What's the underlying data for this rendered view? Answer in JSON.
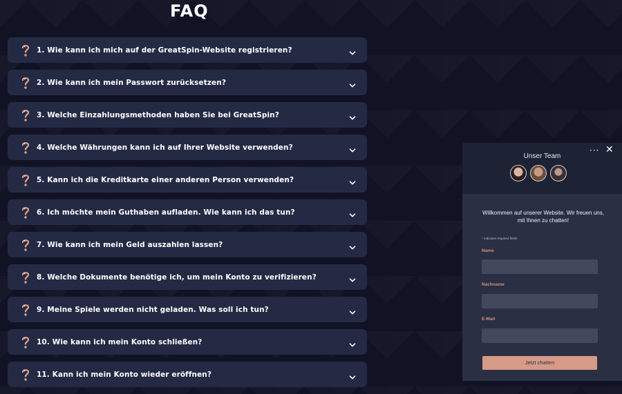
{
  "page": {
    "title": "FAQ"
  },
  "faq": {
    "items": [
      {
        "label": "1. Wie kann ich mich auf der GreatSpin-Website registrieren?"
      },
      {
        "label": "2. Wie kann ich mein Passwort zurücksetzen?"
      },
      {
        "label": "3. Welche Einzahlungsmethoden haben Sie bei GreatSpin?"
      },
      {
        "label": "4. Welche Währungen kann ich auf Ihrer Website verwenden?"
      },
      {
        "label": "5. Kann ich die Kreditkarte einer anderen Person verwenden?"
      },
      {
        "label": "6. Ich möchte mein Guthaben aufladen. Wie kann ich das tun?"
      },
      {
        "label": "7. Wie kann ich mein Geld auszahlen lassen?"
      },
      {
        "label": "8. Welche Dokumente benötige ich, um mein Konto zu verifizieren?"
      },
      {
        "label": "9. Meine Spiele werden nicht geladen. Was soll ich tun?"
      },
      {
        "label": "10. Wie kann ich mein Konto schließen?"
      },
      {
        "label": "11. Kann ich mein Konto wieder eröffnen?"
      }
    ],
    "icon": "question-mark-icon",
    "accent_color": "#e0a187"
  },
  "chat": {
    "team_title": "Unser Team",
    "menu_glyph": "···",
    "close_glyph": "✕",
    "welcome": "Willkommen auf unserer Website. Wir freuen uns, mit Ihnen zu chatten!",
    "required_note_star": "*",
    "required_note": "indicates required fields",
    "fields": {
      "name_label": "Name",
      "surname_label": "Nachname",
      "email_label": "E-Mail"
    },
    "send_label": "Jetzt chatten",
    "accent_color": "#d69a87"
  }
}
